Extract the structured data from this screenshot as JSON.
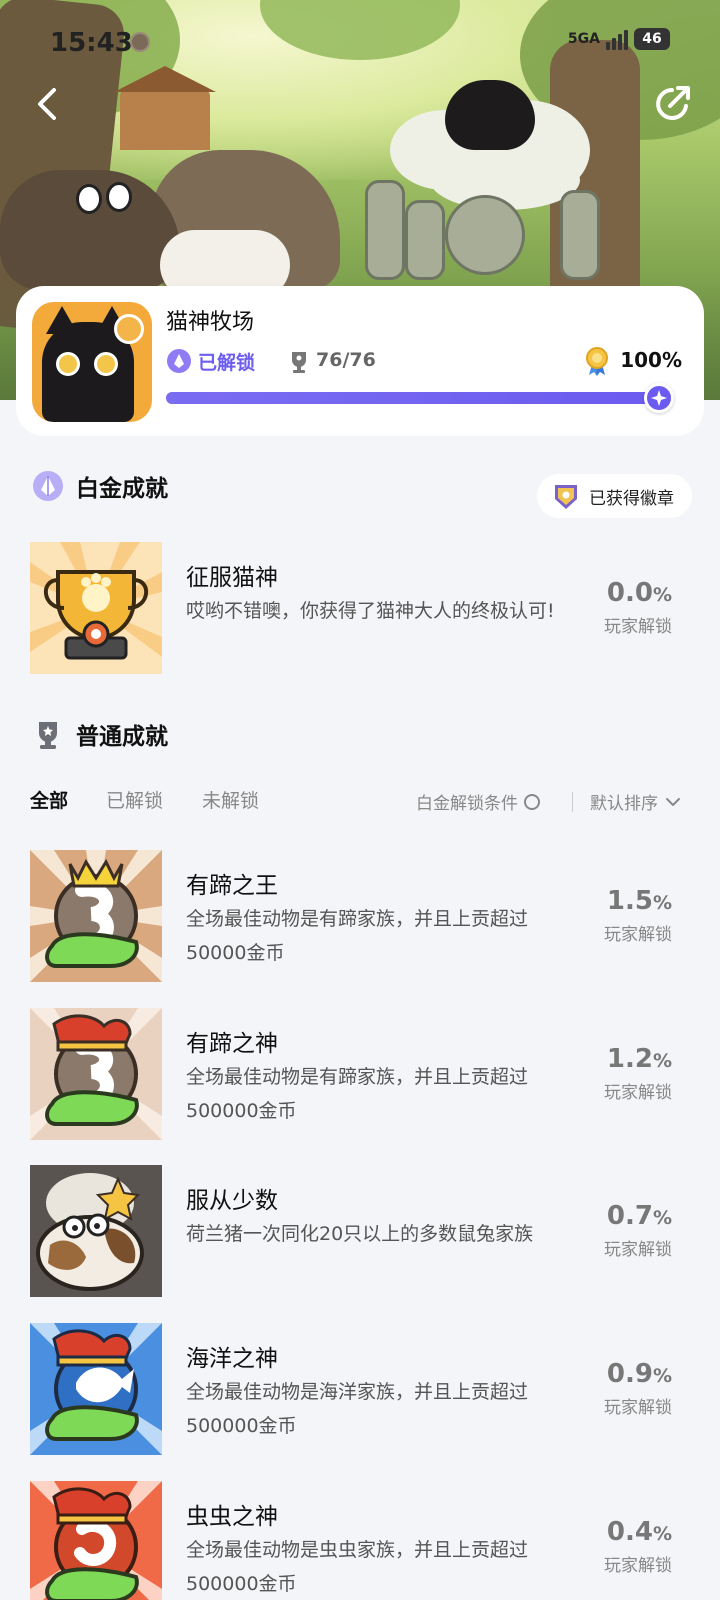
{
  "status_bar": {
    "time": "15:43",
    "network": "5GA",
    "battery": "46"
  },
  "game": {
    "title": "猫神牧场",
    "unlock_status": "已解锁",
    "trophy_count": "76/76",
    "completion": "100%",
    "progress": 1.0
  },
  "platinum_section": {
    "title": "白金成就",
    "badge_button": "已获得徽章"
  },
  "platinum_achievement": {
    "name": "征服猫神",
    "desc": "哎哟不错噢，你获得了猫神大人的终极认可!",
    "pct_value": "0.0",
    "pct_unit": "%",
    "pct_label": "玩家解锁"
  },
  "normal_section": {
    "title": "普通成就"
  },
  "filters": {
    "tabs": [
      "全部",
      "已解锁",
      "未解锁"
    ],
    "active_tab": 0,
    "condition_label": "白金解锁条件",
    "sort_label": "默认排序"
  },
  "achievements": [
    {
      "name": "有蹄之王",
      "desc": "全场最佳动物是有蹄家族，并且上贡超过50000金币",
      "pct_value": "1.5",
      "pct_unit": "%",
      "pct_label": "玩家解锁"
    },
    {
      "name": "有蹄之神",
      "desc": "全场最佳动物是有蹄家族，并且上贡超过500000金币",
      "pct_value": "1.2",
      "pct_unit": "%",
      "pct_label": "玩家解锁"
    },
    {
      "name": "服从少数",
      "desc": "荷兰猪一次同化20只以上的多数鼠兔家族",
      "pct_value": "0.7",
      "pct_unit": "%",
      "pct_label": "玩家解锁"
    },
    {
      "name": "海洋之神",
      "desc": "全场最佳动物是海洋家族，并且上贡超过500000金币",
      "pct_value": "0.9",
      "pct_unit": "%",
      "pct_label": "玩家解锁"
    },
    {
      "name": "虫虫之神",
      "desc": "全场最佳动物是虫虫家族，并且上贡超过500000金币",
      "pct_value": "0.4",
      "pct_unit": "%",
      "pct_label": "玩家解锁"
    }
  ],
  "colors": {
    "accent": "#6b5bf0",
    "background": "#f4f5f8",
    "card": "#ffffff"
  },
  "icons": {
    "back": "chevron-left-icon",
    "share": "share-icon",
    "unlock": "crystal-icon",
    "trophy": "trophy-icon",
    "medal": "medal-icon",
    "sort": "chevron-down-icon"
  }
}
